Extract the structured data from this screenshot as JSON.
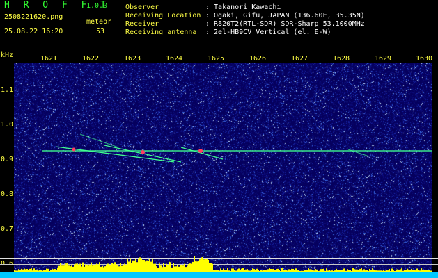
{
  "header": {
    "app_title": "H R O F F T",
    "version": "1.0.0",
    "filename": "2508221620.png",
    "datetime": "25.08.22 16:20",
    "count_label": "meteor",
    "count_value": "53",
    "info": [
      {
        "key": "Observer",
        "value": ": Takanori Kawachi"
      },
      {
        "key": "Receiving Location",
        "value": ": Ogaki, Gifu, JAPAN (136.60E, 35.35N)"
      },
      {
        "key": "Receiver",
        "value": ": R820T2(RTL-SDR) SDR-Sharp 53.1000MHz"
      },
      {
        "key": "Receiving antenna",
        "value": ": 2el-HB9CV Vertical (el. E-W)"
      }
    ]
  },
  "axes": {
    "y_unit": "kHz",
    "x_ticks": [
      "1621",
      "1622",
      "1623",
      "1624",
      "1625",
      "1626",
      "1627",
      "1628",
      "1629",
      "1630"
    ],
    "y_ticks": [
      "1.1",
      "1.0",
      "0.9",
      "0.8",
      "0.7",
      "0.6"
    ]
  },
  "colors": {
    "background": "#05005e",
    "text_green": "#33ff33",
    "text_yellow": "#ffff44",
    "bar": "#ffff00",
    "baseline": "#00c8ff",
    "trace": "#40ff90",
    "signal_core": "#ff4060"
  }
}
